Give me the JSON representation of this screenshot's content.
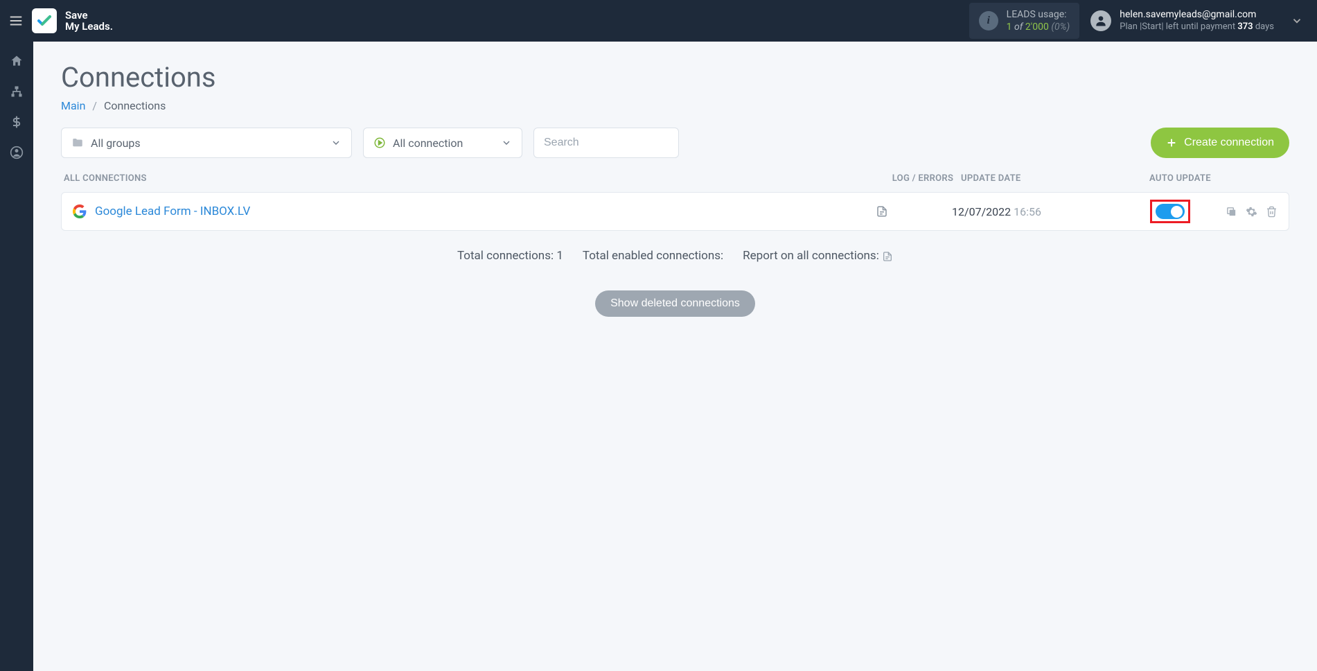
{
  "header": {
    "logo_line1": "Save",
    "logo_line2": "My Leads.",
    "usage_label": "LEADS usage:",
    "usage_current": "1",
    "usage_of": " of ",
    "usage_limit": "2'000",
    "usage_pct": "(0%)",
    "user_email": "helen.savemyleads@gmail.com",
    "plan_prefix": "Plan |",
    "plan_name": "Start",
    "plan_mid": "| left until payment ",
    "plan_days": "373",
    "plan_suffix": " days"
  },
  "page": {
    "title": "Connections",
    "breadcrumb_main": "Main",
    "breadcrumb_current": "Connections"
  },
  "filters": {
    "groups_label": "All groups",
    "conn_label": "All connection",
    "search_placeholder": "Search",
    "create_label": "Create connection"
  },
  "columns": {
    "name": "ALL CONNECTIONS",
    "log": "LOG / ERRORS",
    "date": "UPDATE DATE",
    "auto": "AUTO UPDATE"
  },
  "rows": [
    {
      "name": "Google Lead Form - INBOX.LV",
      "date": "12/07/2022",
      "time": "16:56",
      "auto_update": true
    }
  ],
  "summary": {
    "total_label": "Total connections: ",
    "total_value": "1",
    "enabled_label": "Total enabled connections:",
    "report_label": "Report on all connections:"
  },
  "show_deleted": "Show deleted connections"
}
